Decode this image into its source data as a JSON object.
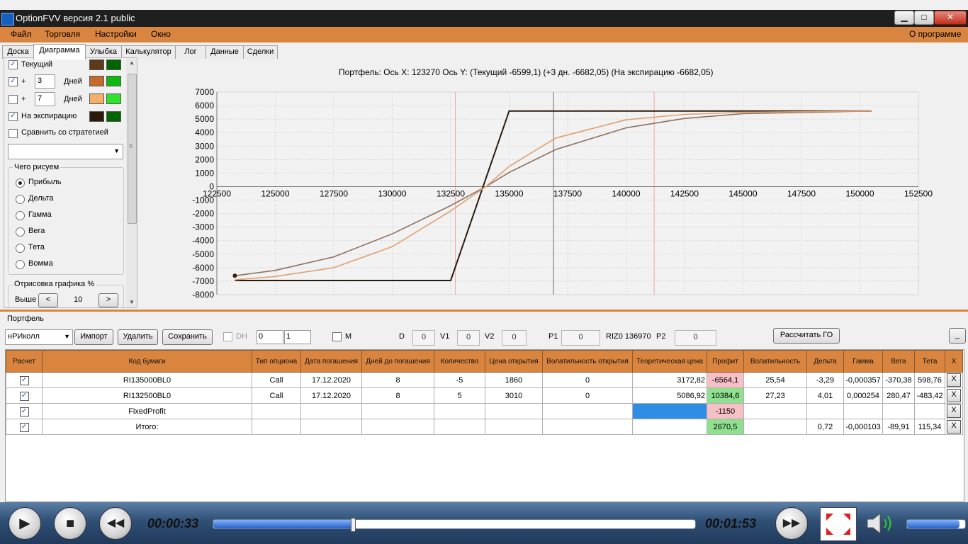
{
  "window": {
    "title": "OptionFVV версия 2.1 public",
    "minimize": "▁",
    "maximize": "□",
    "close": "✕"
  },
  "menu": {
    "items": [
      "Файл",
      "Торговля",
      "Настройки",
      "Окно"
    ],
    "about": "О программе"
  },
  "tabs": [
    "Доска",
    "Диаграмма",
    "Улыбка",
    "Калькулятор",
    "Лог",
    "Данные",
    "Сделки"
  ],
  "active_tab": "Диаграмма",
  "left_panel": {
    "current": {
      "label": "Текущий",
      "checked": true,
      "colors": [
        "#5c3a1a",
        "#006400"
      ]
    },
    "plus3": {
      "plus": "+",
      "days_value": "3",
      "days_label": "Дней",
      "checked": true,
      "colors": [
        "#c46a2c",
        "#0fb80f"
      ]
    },
    "plus7": {
      "plus": "+",
      "days_value": "7",
      "days_label": "Дней",
      "checked": false,
      "colors": [
        "#f4b06a",
        "#2ee22e"
      ]
    },
    "expiration": {
      "label": "На экспирацию",
      "checked": true,
      "colors": [
        "#2b1a0a",
        "#006400"
      ]
    },
    "compare": {
      "label": "Сравнить со стратегией",
      "checked": false
    },
    "draw_group": {
      "title": "Чего рисуем",
      "options": [
        "Прибыль",
        "Дельта",
        "Гамма",
        "Вега",
        "Тета",
        "Вомма"
      ],
      "selected": "Прибыль"
    },
    "render_group": {
      "title": "Отрисовка графика %",
      "above_label": "Выше",
      "value": "10",
      "prev": "<",
      "next": ">"
    },
    "check_mark": "✓",
    "dropdown_arrow": "▼",
    "scroll_up": "▲",
    "scroll_down": "▼",
    "scroll_grip": "≡"
  },
  "chart_data": {
    "type": "line",
    "title": "Портфель: Ось X: 123270 Ось Y:  (Текущий -6599,1)  (+3 дн. -6682,05)  (На экспирацию -6682,05)",
    "xlim": [
      122500,
      152500
    ],
    "ylim": [
      -8000,
      7000
    ],
    "x_ticks": [
      122500,
      125000,
      127500,
      130000,
      132500,
      135000,
      137500,
      140000,
      142500,
      145000,
      147500,
      150000,
      152500
    ],
    "y_ticks": [
      7000,
      6000,
      5000,
      4000,
      3000,
      2000,
      1000,
      0,
      -1000,
      -2000,
      -3000,
      -4000,
      -5000,
      -6000,
      -7000,
      -8000
    ],
    "grid": true,
    "vertical_markers": {
      "red": [
        132700,
        141200
      ],
      "gray": [
        136900
      ]
    },
    "series": [
      {
        "color": "#2b1a0a",
        "x": [
          123270,
          125000,
          127500,
          130000,
          132500,
          132500,
          135000,
          137500,
          140000,
          145000,
          150500
        ],
        "y": [
          -6950,
          -6950,
          -6950,
          -6950,
          -6950,
          -6950,
          5600,
          5600,
          5600,
          5600,
          5600
        ]
      },
      {
        "color": "#8b7060",
        "x": [
          123270,
          125000,
          127500,
          130000,
          132500,
          134000,
          135000,
          137000,
          140000,
          142500,
          145000,
          150500
        ],
        "y": [
          -6600,
          -6200,
          -5200,
          -3500,
          -1400,
          0,
          1050,
          2750,
          4350,
          5050,
          5400,
          5600
        ]
      },
      {
        "color": "#e0a070",
        "x": [
          123270,
          125000,
          127500,
          130000,
          132500,
          134000,
          135000,
          137000,
          140000,
          142500,
          145000,
          150500
        ],
        "y": [
          -6900,
          -6650,
          -6000,
          -4450,
          -1800,
          0,
          1500,
          3600,
          4950,
          5350,
          5500,
          5600
        ]
      }
    ]
  },
  "portfolio": {
    "label": "Портфель",
    "name": "нРИколл",
    "buttons": {
      "import": "Импорт",
      "delete": "Удалить",
      "save": "Сохранить",
      "calc": "Рассчитать ГО",
      "min": "_"
    },
    "dh": {
      "label": "DH",
      "v1": "0",
      "v2": "1"
    },
    "m_label": "M",
    "d": {
      "label": "D",
      "value": "0"
    },
    "v1": {
      "label": "V1",
      "value": "0"
    },
    "v2": {
      "label": "V2",
      "value": "0"
    },
    "p1": {
      "label": "P1",
      "value": "0"
    },
    "riz": "RIZ0 136970",
    "p2": {
      "label": "P2",
      "value": "0"
    }
  },
  "table": {
    "headers": [
      "Расчет",
      "Код бумаги",
      "Тип опциона",
      "Дата погашения",
      "Дней до погашения",
      "Количество",
      "Цена открытия",
      "Волатильность открытия",
      "Теоретическая цена",
      "Профит",
      "Волатильность",
      "Дельта",
      "Гамма",
      "Вега",
      "Тета",
      "X"
    ],
    "rows": [
      {
        "check": true,
        "code": "RI135000BL0",
        "type": "Call",
        "date": "17.12.2020",
        "days": "8",
        "qty": "-5",
        "open_price": "1860",
        "open_vol": "0",
        "theo": "3172,82",
        "profit": "-6564,1",
        "profit_kind": "neg",
        "vol": "25,54",
        "delta": "-3,29",
        "gamma": "-0,000357",
        "vega": "-370,38",
        "theta": "598,76"
      },
      {
        "check": true,
        "code": "RI132500BL0",
        "type": "Call",
        "date": "17.12.2020",
        "days": "8",
        "qty": "5",
        "open_price": "3010",
        "open_vol": "0",
        "theo": "5086,92",
        "profit": "10384,6",
        "profit_kind": "pos",
        "vol": "27,23",
        "delta": "4,01",
        "gamma": "0,000254",
        "vega": "280,47",
        "theta": "-483,42"
      },
      {
        "check": true,
        "code": "FixedProfit",
        "type": "",
        "date": "",
        "days": "",
        "qty": "",
        "open_price": "",
        "open_vol": "",
        "theo": "",
        "theo_selected": true,
        "profit": "-1150",
        "profit_kind": "neg",
        "vol": "",
        "delta": "",
        "gamma": "",
        "vega": "",
        "theta": ""
      },
      {
        "check": true,
        "code": "Итого:",
        "type": "",
        "date": "",
        "days": "",
        "qty": "",
        "open_price": "",
        "open_vol": "",
        "theo": "",
        "profit": "2670,5",
        "profit_kind": "pos",
        "vol": "",
        "delta": "0,72",
        "gamma": "-0,000103",
        "vega": "-89,91",
        "theta": "115,34"
      }
    ],
    "delete_label": "X"
  },
  "player": {
    "elapsed": "00:00:33",
    "total": "00:01:53",
    "progress": 0.29,
    "volume": 0.9,
    "icons": {
      "play": "▶",
      "stop": "■",
      "rewind": "◀◀",
      "forward": "▶▶"
    }
  }
}
